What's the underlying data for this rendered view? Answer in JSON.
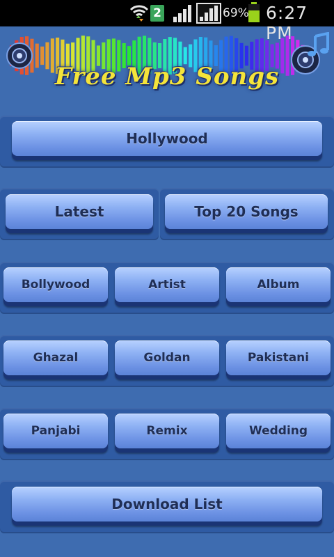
{
  "status_bar": {
    "sim_slot": "2",
    "battery_percent": "69%",
    "time": "6:27 PM",
    "icons": [
      "wifi-icon",
      "sim-icon",
      "signal-icon",
      "signal-icon",
      "battery-icon"
    ],
    "battery_color": "#9ad21b"
  },
  "banner": {
    "title": "Free Mp3 Songs",
    "title_color": "#f4e43a"
  },
  "menu": {
    "hollywood": "Hollywood",
    "latest": "Latest",
    "top20": "Top 20 Songs",
    "bollywood": "Bollywood",
    "artist": "Artist",
    "album": "Album",
    "ghazal": "Ghazal",
    "goldan": "Goldan",
    "pakistani": "Pakistani",
    "panjabi": "Panjabi",
    "remix": "Remix",
    "wedding": "Wedding",
    "download_list": "Download List"
  },
  "colors": {
    "background": "#3e6cb0",
    "panel": "#2f5ba3",
    "button_text": "#1f2e55"
  }
}
